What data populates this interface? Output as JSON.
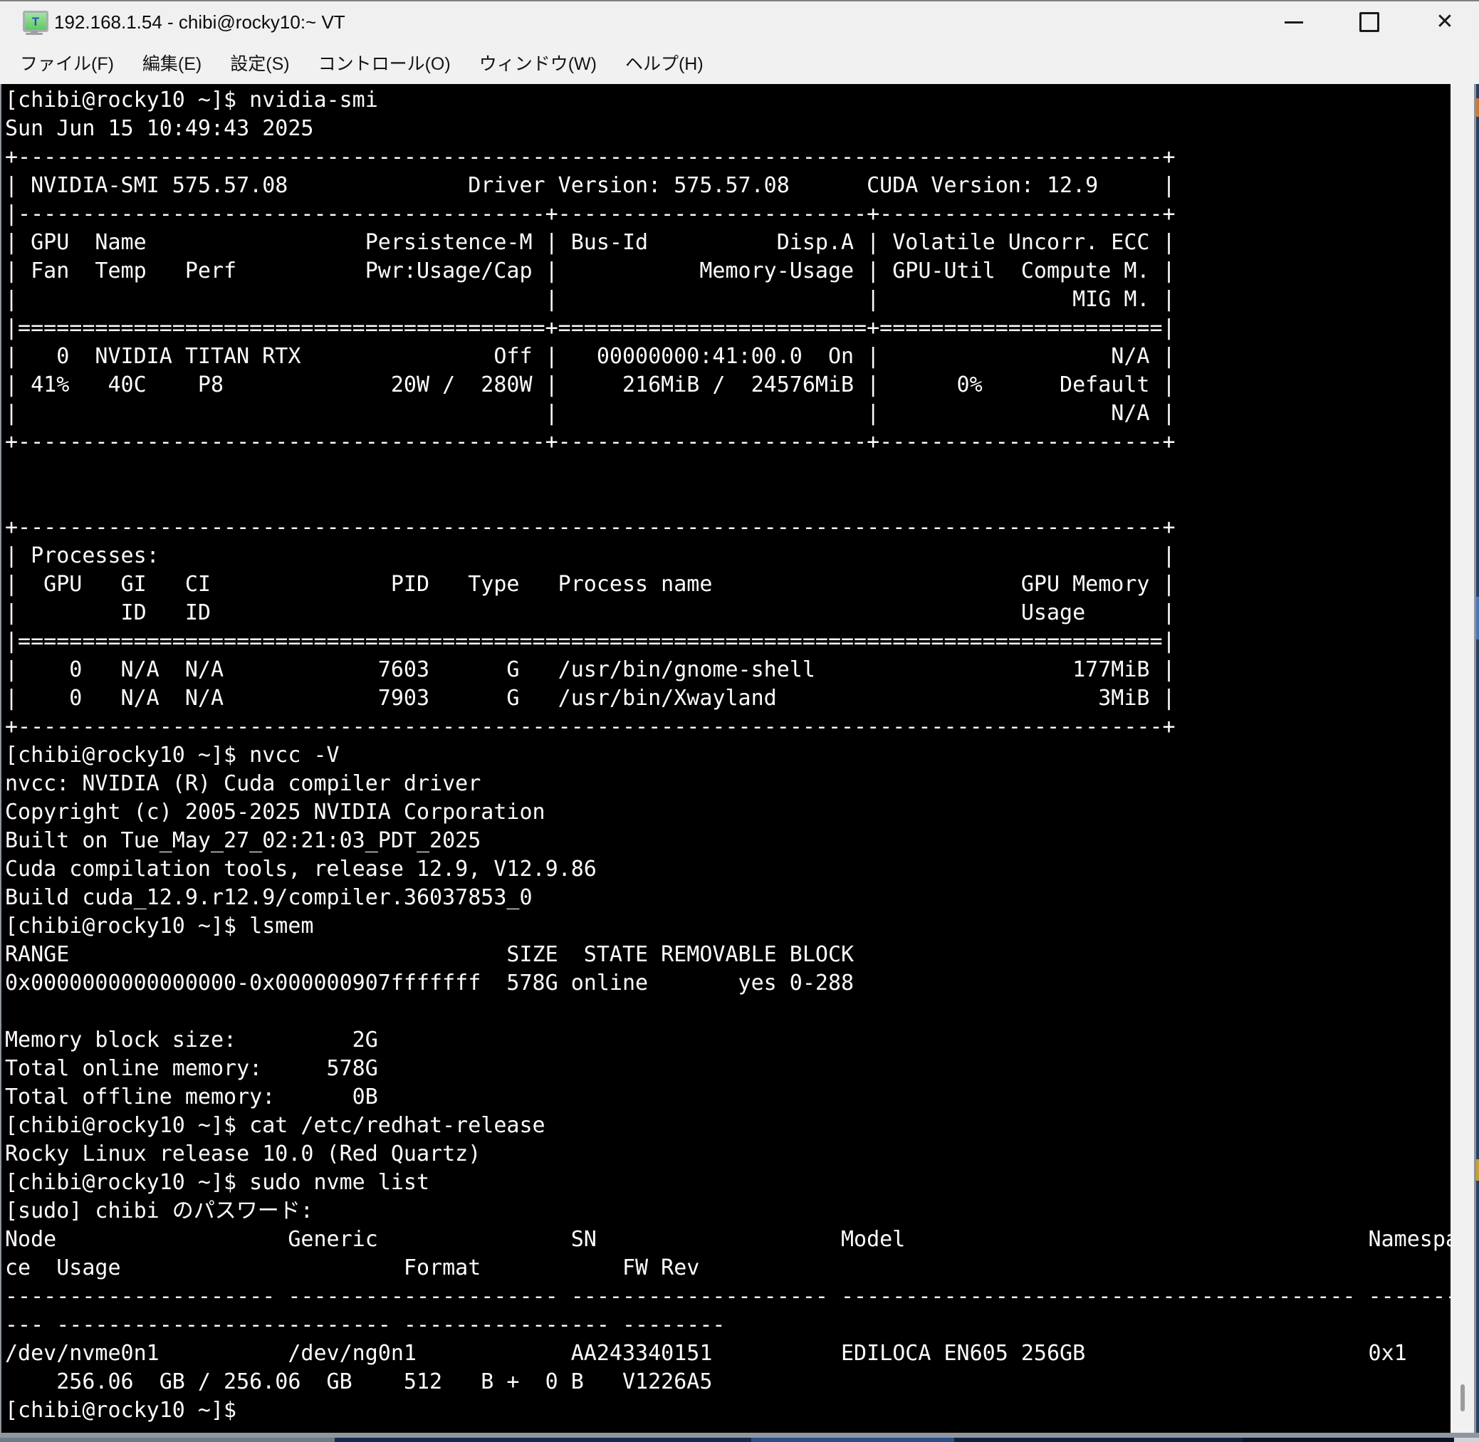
{
  "window": {
    "title": "192.168.1.54 - chibi@rocky10:~ VT",
    "app_icon": {
      "name": "teraterm-monitor-icon",
      "letter": "T",
      "screen_color": "#7ed87e",
      "letter_color": "#2b50c8",
      "body_color": "#a9aeb4"
    },
    "controls": {
      "minimize_glyph": "─",
      "maximize_glyph": "□",
      "close_glyph": "✕"
    }
  },
  "menu": {
    "items": [
      {
        "label": "ファイル(F)"
      },
      {
        "label": "編集(E)"
      },
      {
        "label": "設定(S)"
      },
      {
        "label": "コントロール(O)"
      },
      {
        "label": "ウィンドウ(W)"
      },
      {
        "label": "ヘルプ(H)"
      }
    ]
  },
  "terminal": {
    "colors": {
      "background": "#000000",
      "foreground": "#fdfdfd"
    },
    "prompt": "[chibi@rocky10 ~]$",
    "commands": [
      "nvidia-smi",
      "nvcc -V",
      "lsmem",
      "cat /etc/redhat-release",
      "sudo nvme list"
    ],
    "lines": [
      "[chibi@rocky10 ~]$ nvidia-smi",
      "Sun Jun 15 10:49:43 2025",
      "+-----------------------------------------------------------------------------------------+",
      "| NVIDIA-SMI 575.57.08              Driver Version: 575.57.08      CUDA Version: 12.9     |",
      "|-----------------------------------------+------------------------+----------------------+",
      "| GPU  Name                 Persistence-M | Bus-Id          Disp.A | Volatile Uncorr. ECC |",
      "| Fan  Temp   Perf          Pwr:Usage/Cap |           Memory-Usage | GPU-Util  Compute M. |",
      "|                                         |                        |               MIG M. |",
      "|=========================================+========================+======================|",
      "|   0  NVIDIA TITAN RTX               Off |   00000000:41:00.0  On |                  N/A |",
      "| 41%   40C    P8             20W /  280W |     216MiB /  24576MiB |      0%      Default |",
      "|                                         |                        |                  N/A |",
      "+-----------------------------------------+------------------------+----------------------+",
      "",
      "",
      "+-----------------------------------------------------------------------------------------+",
      "| Processes:                                                                              |",
      "|  GPU   GI   CI              PID   Type   Process name                        GPU Memory |",
      "|        ID   ID                                                               Usage      |",
      "|=========================================================================================|",
      "|    0   N/A  N/A            7603      G   /usr/bin/gnome-shell                    177MiB |",
      "|    0   N/A  N/A            7903      G   /usr/bin/Xwayland                         3MiB |",
      "+-----------------------------------------------------------------------------------------+",
      "[chibi@rocky10 ~]$ nvcc -V",
      "nvcc: NVIDIA (R) Cuda compiler driver",
      "Copyright (c) 2005-2025 NVIDIA Corporation",
      "Built on Tue_May_27_02:21:03_PDT_2025",
      "Cuda compilation tools, release 12.9, V12.9.86",
      "Build cuda_12.9.r12.9/compiler.36037853_0",
      "[chibi@rocky10 ~]$ lsmem",
      "RANGE                                  SIZE  STATE REMOVABLE BLOCK",
      "0x0000000000000000-0x000000907fffffff  578G online       yes 0-288",
      "",
      "Memory block size:         2G",
      "Total online memory:     578G",
      "Total offline memory:      0B",
      "[chibi@rocky10 ~]$ cat /etc/redhat-release",
      "Rocky Linux release 10.0 (Red Quartz)",
      "[chibi@rocky10 ~]$ sudo nvme list",
      "[sudo] chibi のパスワード:",
      "Node                  Generic               SN                   Model                                    Namespa",
      "ce  Usage                      Format           FW Rev",
      "--------------------- --------------------- -------------------- ---------------------------------------- -------",
      "--- -------------------------- ---------------- --------",
      "/dev/nvme0n1          /dev/ng0n1            AA243340151          EDILOCA EN605 256GB                      0x1",
      "    256.06  GB / 256.06  GB    512   B +  0 B   V1226A5",
      "[chibi@rocky10 ~]$ "
    ]
  }
}
